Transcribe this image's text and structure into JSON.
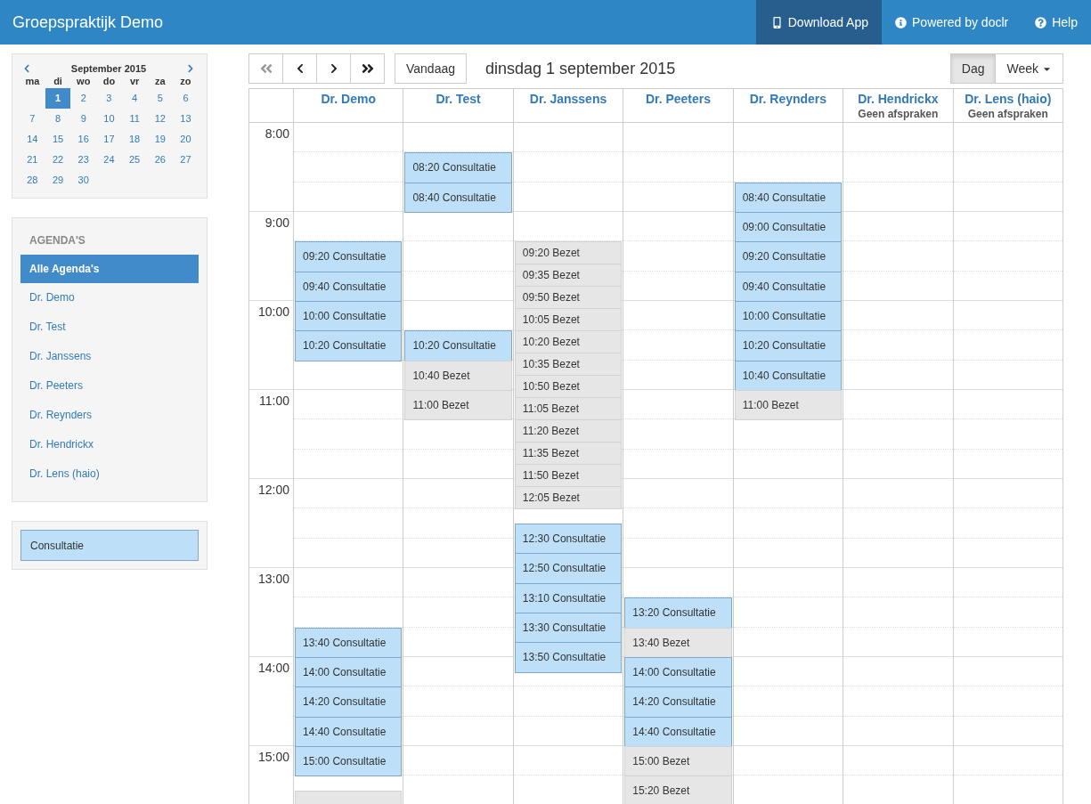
{
  "app_title": "Groepspraktijk Demo",
  "nav_links": [
    {
      "label": "Download App",
      "selected": true
    },
    {
      "label": "Powered by doclr",
      "selected": false
    },
    {
      "label": "Help",
      "selected": false
    }
  ],
  "mini_calendar": {
    "month": "September 2015",
    "weekdays": [
      "ma",
      "di",
      "wo",
      "do",
      "vr",
      "za",
      "zo"
    ],
    "weeks": [
      [
        {
          "day": "1",
          "selected": true
        },
        {
          "day": "2",
          "selected": false
        },
        {
          "day": "3",
          "selected": false
        },
        {
          "day": "4",
          "selected": false
        },
        {
          "day": "5",
          "selected": false
        },
        {
          "day": "6",
          "selected": false
        }
      ],
      [
        {
          "day": "7",
          "selected": false
        },
        {
          "day": "8",
          "selected": false
        },
        {
          "day": "9",
          "selected": false
        },
        {
          "day": "10",
          "selected": false
        },
        {
          "day": "11",
          "selected": false
        },
        {
          "day": "12",
          "selected": false
        },
        {
          "day": "13",
          "selected": false
        }
      ],
      [
        {
          "day": "14",
          "selected": false
        },
        {
          "day": "15",
          "selected": false
        },
        {
          "day": "16",
          "selected": false
        },
        {
          "day": "17",
          "selected": false
        },
        {
          "day": "18",
          "selected": false
        },
        {
          "day": "19",
          "selected": false
        },
        {
          "day": "20",
          "selected": false
        }
      ],
      [
        {
          "day": "21",
          "selected": false
        },
        {
          "day": "22",
          "selected": false
        },
        {
          "day": "23",
          "selected": false
        },
        {
          "day": "24",
          "selected": false
        },
        {
          "day": "25",
          "selected": false
        },
        {
          "day": "26",
          "selected": false
        },
        {
          "day": "27",
          "selected": false
        }
      ],
      [
        {
          "day": "28",
          "selected": false
        },
        {
          "day": "29",
          "selected": false
        },
        {
          "day": "30",
          "selected": false
        }
      ]
    ]
  },
  "agendas": {
    "heading": "AGENDA'S",
    "items": [
      {
        "label": "Alle Agenda's",
        "selected": true
      },
      {
        "label": "Dr. Demo",
        "selected": false
      },
      {
        "label": "Dr. Test",
        "selected": false
      },
      {
        "label": "Dr. Janssens",
        "selected": false
      },
      {
        "label": "Dr. Peeters",
        "selected": false
      },
      {
        "label": "Dr. Reynders",
        "selected": false
      },
      {
        "label": "Dr. Hendrickx",
        "selected": false
      },
      {
        "label": "Dr. Lens (haio)",
        "selected": false
      }
    ]
  },
  "legend": [
    {
      "label": "Consultatie",
      "kind": "consult"
    }
  ],
  "toolbar": {
    "nav_buttons": [
      {
        "kind": "first",
        "disabled": true
      },
      {
        "kind": "prev",
        "disabled": false
      },
      {
        "kind": "next",
        "disabled": false
      },
      {
        "kind": "last",
        "disabled": false
      }
    ],
    "today_button": "Vandaag",
    "date_title": "dinsdag 1 september 2015",
    "view_buttons": [
      {
        "label": "Dag",
        "selected": true,
        "dropdown": false
      },
      {
        "label": "Week",
        "selected": false,
        "dropdown": true
      }
    ]
  },
  "time_labels": [
    "8:00",
    "9:00",
    "10:00",
    "11:00",
    "12:00",
    "13:00",
    "14:00",
    "15:00"
  ],
  "columns": [
    {
      "name": "Dr. Demo",
      "events": [
        {
          "time": "09:20",
          "label": "Consultatie",
          "kind": "consult"
        },
        {
          "time": "09:40",
          "label": "Consultatie",
          "kind": "consult"
        },
        {
          "time": "10:00",
          "label": "Consultatie",
          "kind": "consult"
        },
        {
          "time": "10:20",
          "label": "Consultatie",
          "kind": "consult"
        },
        {
          "time": "13:40",
          "label": "Consultatie",
          "kind": "consult"
        },
        {
          "time": "14:00",
          "label": "Consultatie",
          "kind": "consult"
        },
        {
          "time": "14:20",
          "label": "Consultatie",
          "kind": "consult"
        },
        {
          "time": "14:40",
          "label": "Consultatie",
          "kind": "consult"
        },
        {
          "time": "15:00",
          "label": "Consultatie",
          "kind": "consult"
        },
        {
          "kind": "busy"
        }
      ]
    },
    {
      "name": "Dr. Test",
      "events": [
        {
          "time": "08:20",
          "label": "Consultatie",
          "kind": "consult"
        },
        {
          "time": "08:40",
          "label": "Consultatie",
          "kind": "consult"
        },
        {
          "time": "10:20",
          "label": "Consultatie",
          "kind": "consult"
        },
        {
          "time": "10:40",
          "label": "Bezet",
          "kind": "busy"
        },
        {
          "time": "11:00",
          "label": "Bezet",
          "kind": "busy"
        }
      ]
    },
    {
      "name": "Dr. Janssens",
      "events": [
        {
          "time": "09:20",
          "label": "Bezet",
          "kind": "busy"
        },
        {
          "time": "09:35",
          "label": "Bezet",
          "kind": "busy"
        },
        {
          "time": "09:50",
          "label": "Bezet",
          "kind": "busy"
        },
        {
          "time": "10:05",
          "label": "Bezet",
          "kind": "busy"
        },
        {
          "time": "10:20",
          "label": "Bezet",
          "kind": "busy"
        },
        {
          "time": "10:35",
          "label": "Bezet",
          "kind": "busy"
        },
        {
          "time": "10:50",
          "label": "Bezet",
          "kind": "busy"
        },
        {
          "time": "11:05",
          "label": "Bezet",
          "kind": "busy"
        },
        {
          "time": "11:20",
          "label": "Bezet",
          "kind": "busy"
        },
        {
          "time": "11:35",
          "label": "Bezet",
          "kind": "busy"
        },
        {
          "time": "11:50",
          "label": "Bezet",
          "kind": "busy"
        },
        {
          "time": "12:05",
          "label": "Bezet",
          "kind": "busy"
        },
        {
          "time": "12:30",
          "label": "Consultatie",
          "kind": "consult"
        },
        {
          "time": "12:50",
          "label": "Consultatie",
          "kind": "consult"
        },
        {
          "time": "13:10",
          "label": "Consultatie",
          "kind": "consult"
        },
        {
          "time": "13:30",
          "label": "Consultatie",
          "kind": "consult"
        },
        {
          "time": "13:50",
          "label": "Consultatie",
          "kind": "consult"
        }
      ]
    },
    {
      "name": "Dr. Peeters",
      "events": [
        {
          "time": "13:20",
          "label": "Consultatie",
          "kind": "consult"
        },
        {
          "time": "13:40",
          "label": "Bezet",
          "kind": "busy"
        },
        {
          "time": "14:00",
          "label": "Consultatie",
          "kind": "consult"
        },
        {
          "time": "14:20",
          "label": "Consultatie",
          "kind": "consult"
        },
        {
          "time": "14:40",
          "label": "Consultatie",
          "kind": "consult"
        },
        {
          "time": "15:00",
          "label": "Bezet",
          "kind": "busy"
        },
        {
          "time": "15:20",
          "label": "Bezet",
          "kind": "busy"
        }
      ]
    },
    {
      "name": "Dr. Reynders",
      "events": [
        {
          "time": "08:40",
          "label": "Consultatie",
          "kind": "consult"
        },
        {
          "time": "09:00",
          "label": "Consultatie",
          "kind": "consult"
        },
        {
          "time": "09:20",
          "label": "Consultatie",
          "kind": "consult"
        },
        {
          "time": "09:40",
          "label": "Consultatie",
          "kind": "consult"
        },
        {
          "time": "10:00",
          "label": "Consultatie",
          "kind": "consult"
        },
        {
          "time": "10:20",
          "label": "Consultatie",
          "kind": "consult"
        },
        {
          "time": "10:40",
          "label": "Consultatie",
          "kind": "consult"
        },
        {
          "time": "11:00",
          "label": "Bezet",
          "kind": "busy"
        }
      ]
    },
    {
      "name": "Dr. Hendrickx",
      "subtitle": "Geen afspraken"
    },
    {
      "name": "Dr. Lens (haio)",
      "subtitle": "Geen afspraken"
    }
  ]
}
